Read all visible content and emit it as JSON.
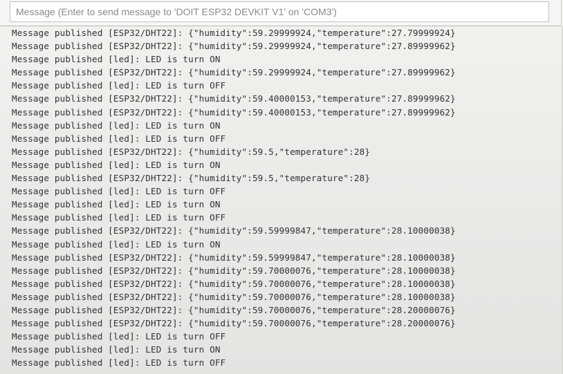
{
  "input": {
    "placeholder": "Message (Enter to send message to 'DOIT ESP32 DEVKIT V1' on 'COM3')"
  },
  "log": [
    "Message published [ESP32/DHT22]: {\"humidity\":59.29999924,\"temperature\":27.79999924}",
    "Message published [ESP32/DHT22]: {\"humidity\":59.29999924,\"temperature\":27.89999962}",
    "Message published [led]: LED is turn ON",
    "Message published [ESP32/DHT22]: {\"humidity\":59.29999924,\"temperature\":27.89999962}",
    "Message published [led]: LED is turn OFF",
    "Message published [ESP32/DHT22]: {\"humidity\":59.40000153,\"temperature\":27.89999962}",
    "Message published [ESP32/DHT22]: {\"humidity\":59.40000153,\"temperature\":27.89999962}",
    "Message published [led]: LED is turn ON",
    "Message published [led]: LED is turn OFF",
    "Message published [ESP32/DHT22]: {\"humidity\":59.5,\"temperature\":28}",
    "Message published [led]: LED is turn ON",
    "Message published [ESP32/DHT22]: {\"humidity\":59.5,\"temperature\":28}",
    "Message published [led]: LED is turn OFF",
    "Message published [led]: LED is turn ON",
    "Message published [led]: LED is turn OFF",
    "Message published [ESP32/DHT22]: {\"humidity\":59.59999847,\"temperature\":28.10000038}",
    "Message published [led]: LED is turn ON",
    "Message published [ESP32/DHT22]: {\"humidity\":59.59999847,\"temperature\":28.10000038}",
    "Message published [ESP32/DHT22]: {\"humidity\":59.70000076,\"temperature\":28.10000038}",
    "Message published [ESP32/DHT22]: {\"humidity\":59.70000076,\"temperature\":28.10000038}",
    "Message published [ESP32/DHT22]: {\"humidity\":59.70000076,\"temperature\":28.10000038}",
    "Message published [ESP32/DHT22]: {\"humidity\":59.70000076,\"temperature\":28.20000076}",
    "Message published [ESP32/DHT22]: {\"humidity\":59.70000076,\"temperature\":28.20000076}",
    "Message published [led]: LED is turn OFF",
    "Message published [led]: LED is turn ON",
    "Message published [led]: LED is turn OFF"
  ]
}
